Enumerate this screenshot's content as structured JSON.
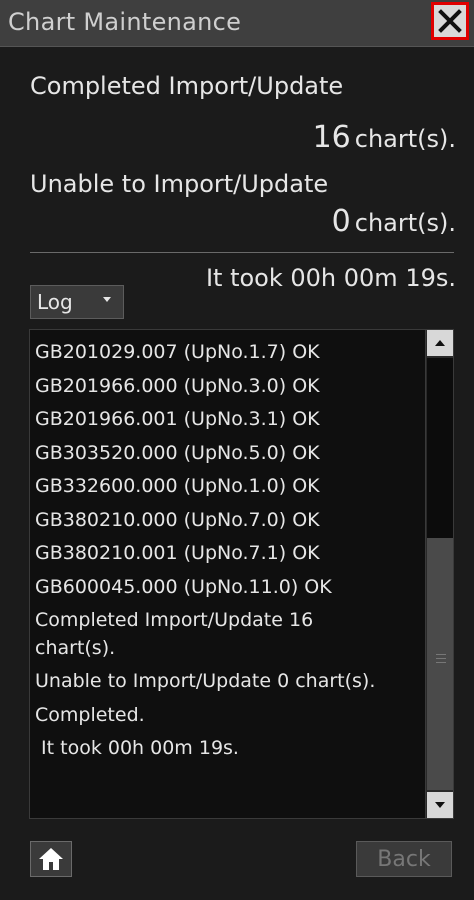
{
  "window": {
    "title": "Chart Maintenance",
    "close_icon": "close-icon"
  },
  "summary": {
    "completed_label": "Completed Import/Update",
    "completed_count": "16",
    "completed_unit": "chart(s).",
    "unable_label": "Unable to Import/Update",
    "unable_count": "0",
    "unable_unit": "chart(s).",
    "duration": "It took 00h 00m 19s."
  },
  "log_select": {
    "value": "Log",
    "icon": "chevron-down-icon"
  },
  "log_lines": [
    "GB201029.007 (UpNo.1.7) OK",
    "GB201966.000 (UpNo.3.0) OK",
    "GB201966.001 (UpNo.3.1) OK",
    "GB303520.000 (UpNo.5.0) OK",
    "GB332600.000 (UpNo.1.0) OK",
    "GB380210.000 (UpNo.7.0) OK",
    "GB380210.001 (UpNo.7.1) OK",
    "GB600045.000 (UpNo.11.0) OK",
    "Completed Import/Update 16 chart(s).",
    "Unable to Import/Update 0 chart(s).",
    "Completed.",
    " It took 00h 00m 19s."
  ],
  "footer": {
    "home_icon": "home-icon",
    "back_label": "Back"
  },
  "colors": {
    "close_border": "#e00000",
    "background": "#1b1b1b",
    "titlebar": "#3f3f3f"
  }
}
